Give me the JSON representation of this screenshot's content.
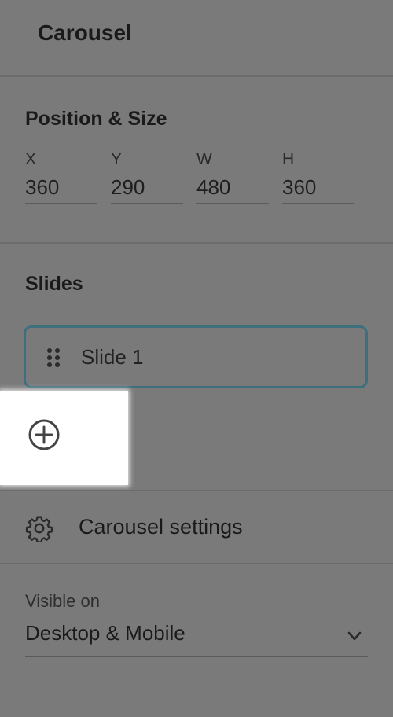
{
  "panel": {
    "title": "Carousel"
  },
  "position_size": {
    "heading": "Position & Size",
    "fields": [
      {
        "label": "X",
        "value": "360"
      },
      {
        "label": "Y",
        "value": "290"
      },
      {
        "label": "W",
        "value": "480"
      },
      {
        "label": "H",
        "value": "360"
      }
    ]
  },
  "slides": {
    "heading": "Slides",
    "items": [
      {
        "label": "Slide 1",
        "icon": "drag-handle-icon"
      }
    ],
    "add_icon": "plus-circle-icon"
  },
  "settings": {
    "label": "Carousel settings",
    "icon": "gear-icon"
  },
  "visibility": {
    "label": "Visible on",
    "selected": "Desktop & Mobile",
    "icon": "chevron-down-icon"
  },
  "colors": {
    "background": "#7a7a7a",
    "selected_border": "#3e6f7c",
    "highlight": "#ffffff"
  }
}
